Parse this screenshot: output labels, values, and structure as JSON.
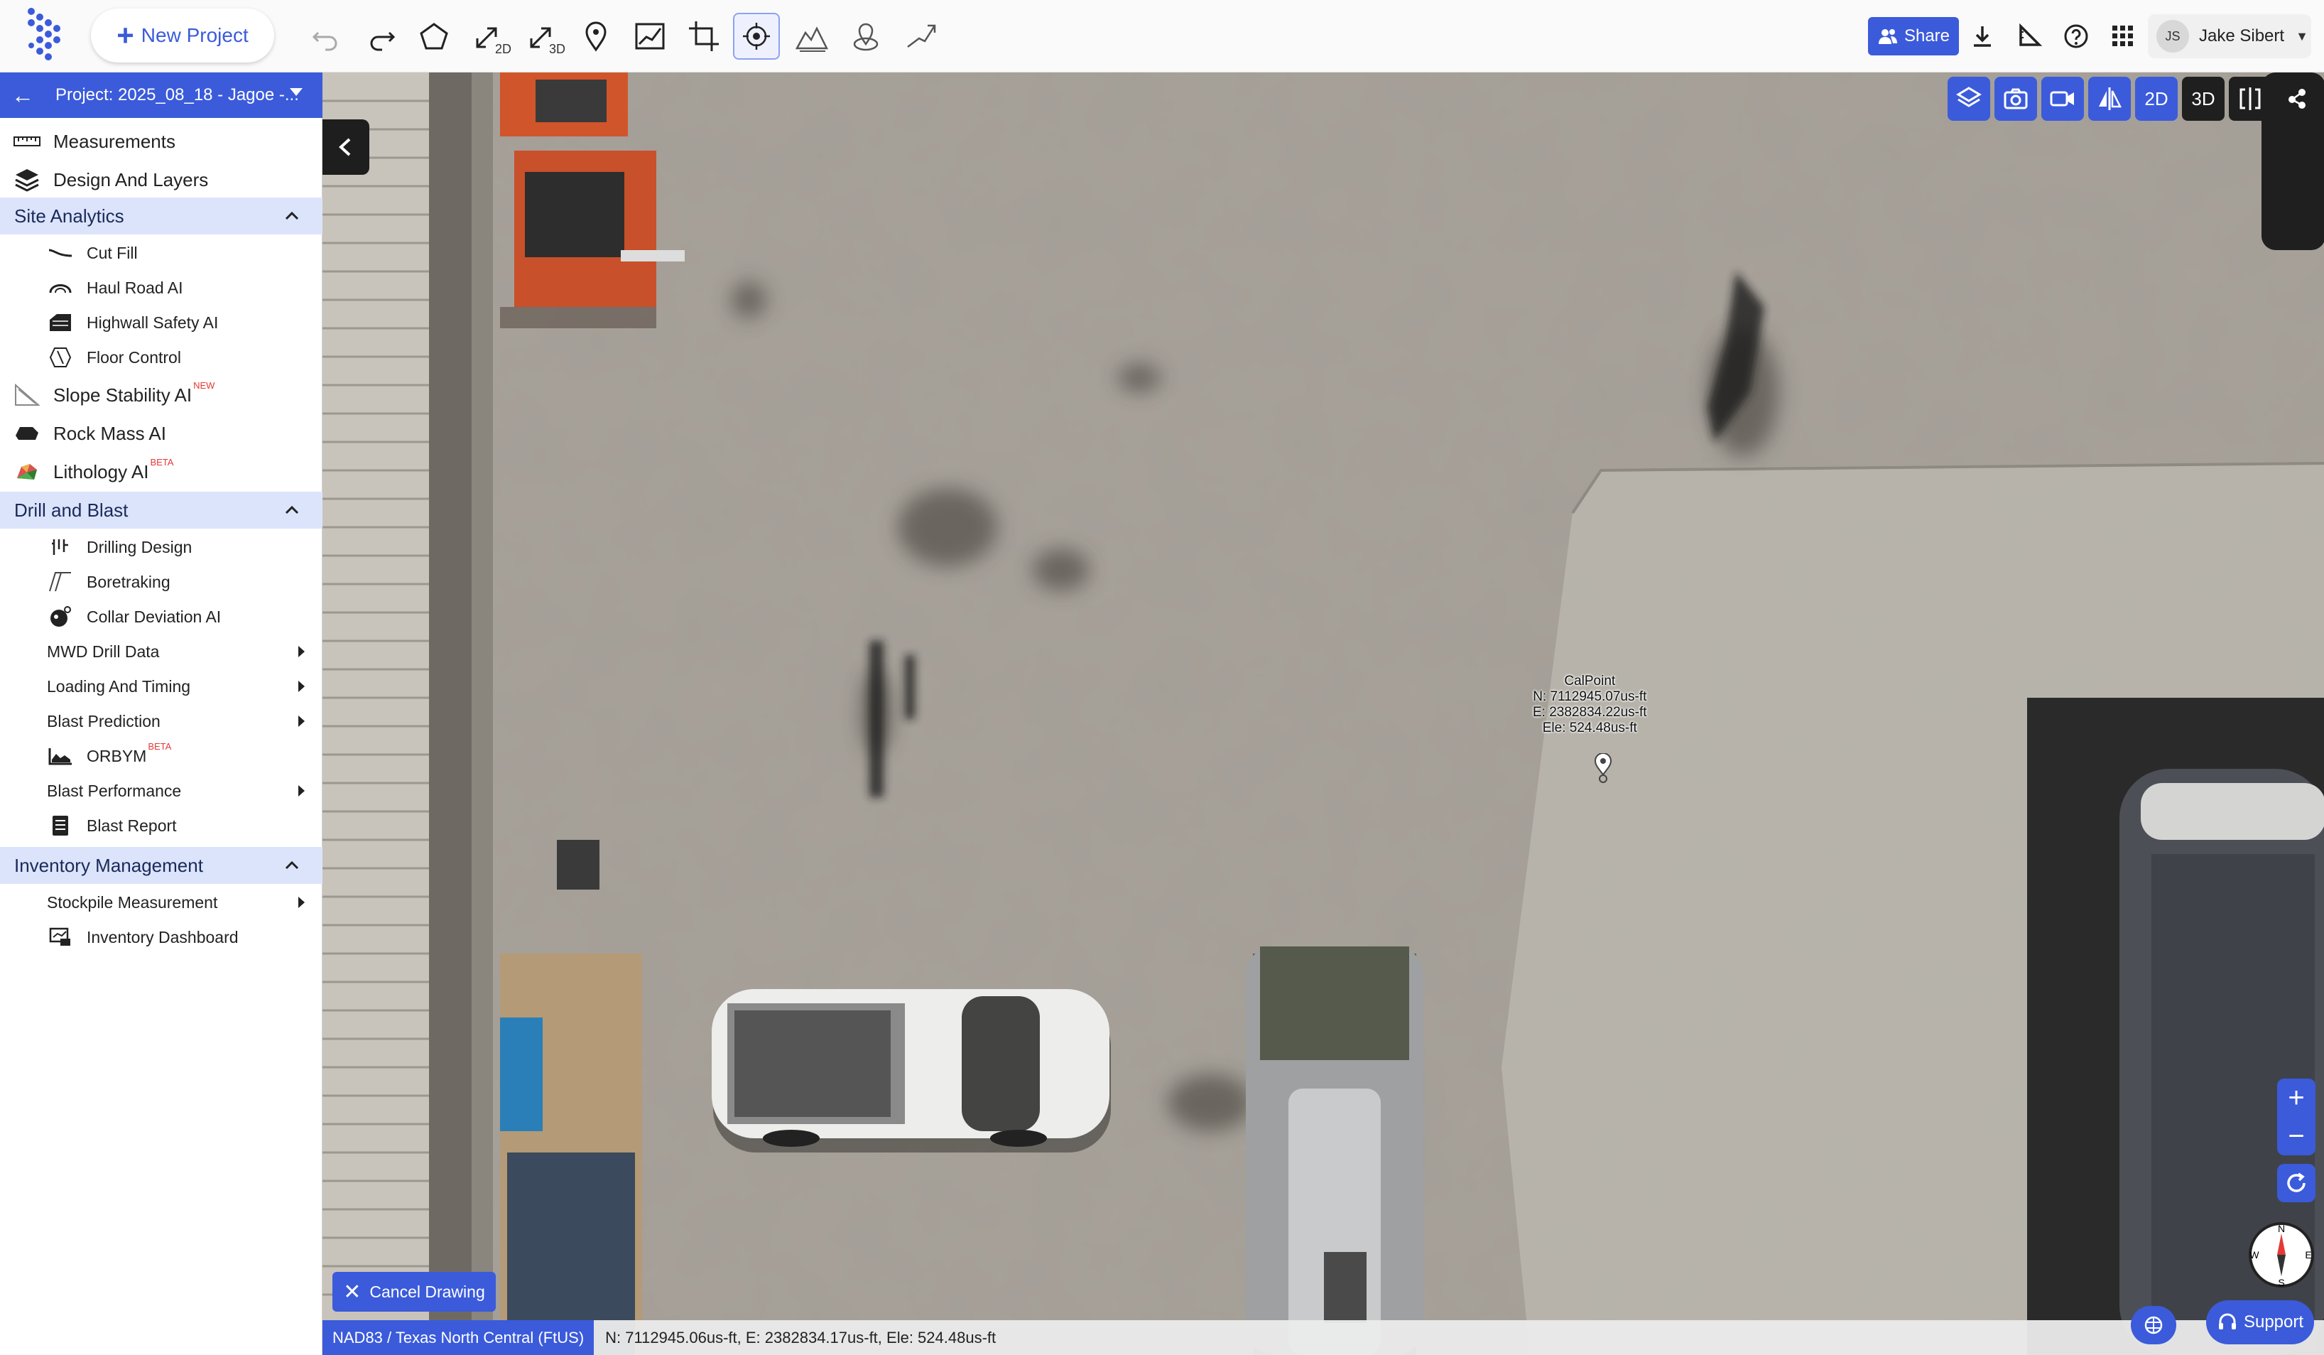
{
  "toolbar": {
    "new_project_label": "New Project",
    "tools": [
      "undo-icon",
      "redo-icon",
      "polygon-icon",
      "measure-2d-icon",
      "measure-3d-icon",
      "location-pin-icon",
      "profile-icon",
      "crop-icon",
      "calpoint-icon",
      "terrain-icon",
      "gps-icon",
      "slope-icon"
    ],
    "tool_2d_suffix": "2D",
    "tool_3d_suffix": "3D",
    "share_label": "Share",
    "user_initials": "JS",
    "user_name": "Jake Sibert"
  },
  "sidebar": {
    "project_label": "Project: 2025_08_18 - Jagoe -...",
    "items": {
      "measurements": "Measurements",
      "design_layers": "Design And Layers",
      "site_analytics": "Site Analytics",
      "cut_fill": "Cut Fill",
      "haul_road": "Haul Road AI",
      "highwall": "Highwall Safety AI",
      "floor_control": "Floor Control",
      "slope_stability": "Slope Stability AI",
      "slope_tag": "NEW",
      "rock_mass": "Rock Mass AI",
      "lithology": "Lithology AI",
      "lithology_tag": "BETA",
      "drill_blast": "Drill and Blast",
      "drilling_design": "Drilling Design",
      "boretraking": "Boretraking",
      "collar_deviation": "Collar Deviation AI",
      "mwd": "MWD Drill Data",
      "loading_timing": "Loading And Timing",
      "blast_prediction": "Blast Prediction",
      "orbym": "ORBYM",
      "orbym_tag": "BETA",
      "blast_performance": "Blast Performance",
      "blast_report": "Blast Report",
      "inventory": "Inventory Management",
      "stockpile": "Stockpile Measurement",
      "inventory_dashboard": "Inventory Dashboard"
    }
  },
  "map": {
    "view_2d": "2D",
    "view_3d": "3D",
    "calpoint": {
      "name": "CalPoint",
      "north": "N: 7112945.07us-ft",
      "east": "E: 2382834.22us-ft",
      "ele": "Ele: 524.48us-ft"
    },
    "compass": {
      "n": "N",
      "s": "S",
      "e": "E",
      "w": "W"
    },
    "cancel_drawing": "Cancel Drawing",
    "crs": "NAD83 / Texas North Central (FtUS)",
    "cursor_coords": "N: 7112945.06us-ft, E: 2382834.17us-ft, Ele: 524.48us-ft",
    "support_label": "Support"
  },
  "colors": {
    "accent": "#3b5bdb",
    "section_bg": "#dce4fb",
    "tag": "#e53935"
  }
}
